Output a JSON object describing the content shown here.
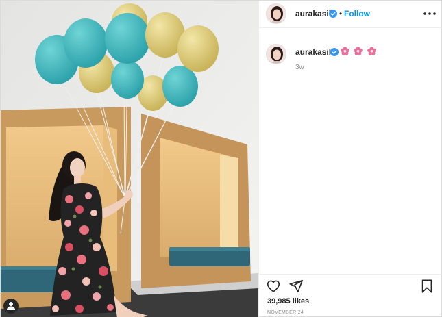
{
  "post": {
    "username": "aurakasih",
    "follow_label": "Follow",
    "separator": "•",
    "caption_emojis": [
      "pink-flower",
      "pink-flower",
      "pink-flower"
    ],
    "time_ago": "3w",
    "likes": "39,985 likes",
    "date": "NOVEMBER 24"
  },
  "photo": {
    "subject": "woman in floral dress holding teal and gold balloons",
    "icons": [
      "user-tag-icon"
    ]
  },
  "colors": {
    "link_blue": "#0095f6",
    "verified_blue": "#3897f0",
    "text_dark": "#262626",
    "text_muted": "#8e8e8e",
    "border": "#efefef",
    "emoji_pink": "#e8709a"
  }
}
